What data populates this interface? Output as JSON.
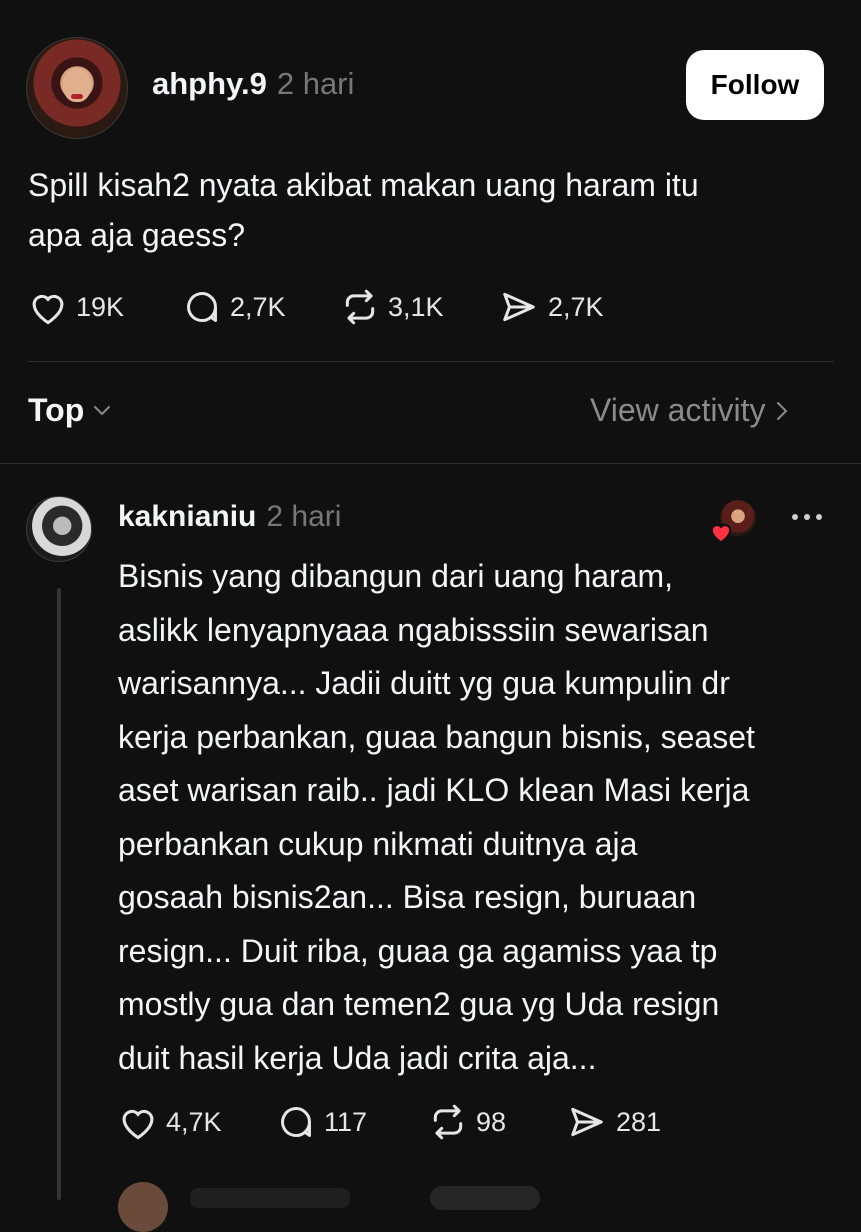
{
  "post": {
    "username": "ahphy.9",
    "time": "2 hari",
    "follow_label": "Follow",
    "text_line1": "Spill kisah2 nyata akibat makan uang haram itu",
    "text_line2": "apa aja gaess?",
    "likes": "19K",
    "comments": "2,7K",
    "reposts": "3,1K",
    "shares": "2,7K"
  },
  "replies_header": {
    "sort_label": "Top",
    "view_activity_label": "View activity"
  },
  "reply": {
    "username": "kaknianiu",
    "time": "2 hari",
    "lines": [
      "Bisnis yang dibangun dari uang haram,",
      "aslikk lenyapnyaaa ngabisssiin sewarisan",
      "warisannya... Jadii duitt yg gua kumpulin dr",
      "kerja perbankan, guaa bangun bisnis, seaset",
      "aset warisan raib.. jadi KLO klean Masi kerja",
      "perbankan cukup nikmati duitnya aja",
      "gosaah bisnis2an... Bisa resign, buruaan",
      "resign... Duit riba, guaa ga agamiss yaa tp",
      "mostly gua dan temen2 gua yg Uda resign",
      "duit hasil kerja Uda jadi crita aja..."
    ],
    "likes": "4,7K",
    "comments": "117",
    "reposts": "98",
    "shares": "281"
  },
  "colors": {
    "background": "#101010",
    "text": "#f3f5f7",
    "muted": "#777777",
    "heart": "#ff3040"
  }
}
